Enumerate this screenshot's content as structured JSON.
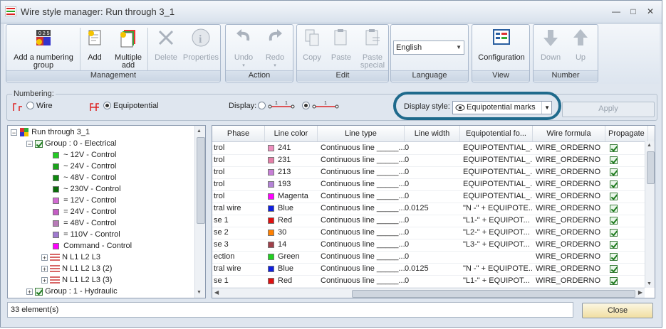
{
  "window": {
    "title": "Wire style manager: Run through 3_1"
  },
  "ribbon": {
    "groups": [
      {
        "label": "Management"
      },
      {
        "label": "Action"
      },
      {
        "label": "Edit"
      },
      {
        "label": "Language"
      },
      {
        "label": "View"
      },
      {
        "label": "Number"
      }
    ],
    "buttons": {
      "add_numbering_group": {
        "line1": "Add a numbering",
        "line2": "group"
      },
      "add": "Add",
      "multiple_add": {
        "line1": "Multiple",
        "line2": "add"
      },
      "delete": "Delete",
      "properties": "Properties",
      "undo": "Undo",
      "redo": "Redo",
      "copy": "Copy",
      "paste": "Paste",
      "paste_special": {
        "line1": "Paste",
        "line2": "special"
      },
      "configuration": "Configuration",
      "down": "Down",
      "up": "Up"
    },
    "language": {
      "value": "English"
    }
  },
  "numbering": {
    "label": "Numbering:",
    "wire": "Wire",
    "equipotential": "Equipotential",
    "display_label": "Display:",
    "display_style_label": "Display style:",
    "display_style_value": "Equipotential marks",
    "apply": "Apply"
  },
  "tree": {
    "root": "Run through 3_1",
    "group0": "Group : 0 - Electrical",
    "items": [
      {
        "label": "~  12V - Control",
        "color": "#22cc22"
      },
      {
        "label": "~  24V - Control",
        "color": "#1aa31a"
      },
      {
        "label": "~  48V - Control",
        "color": "#0e8a0e"
      },
      {
        "label": "~ 230V - Control",
        "color": "#0b6b0b"
      },
      {
        "label": "=  12V - Control",
        "color": "#d26ad2"
      },
      {
        "label": "=  24V - Control",
        "color": "#c45cc4"
      },
      {
        "label": "=  48V - Control",
        "color": "#b77ab7"
      },
      {
        "label": "= 110V - Control",
        "color": "#a07ad0"
      },
      {
        "label": "Command - Control",
        "color": "#ff00ff"
      }
    ],
    "sets": [
      "N L1 L2 L3",
      "N L1 L2 L3 (2)",
      "N L1 L2 L3 (3)"
    ],
    "group1": "Group : 1 - Hydraulic"
  },
  "grid": {
    "headers": [
      "Phase",
      "Line color",
      "Line type",
      "Line width",
      "Equipotential fo...",
      "Wire formula",
      "Propagate"
    ],
    "rows": [
      {
        "phase": "trol",
        "color_name": "241",
        "color": "#ee8fbe",
        "type": "Continuous line _____...",
        "width": "0",
        "equi": "EQUIPOTENTIAL_...",
        "formula": "WIRE_ORDERNO"
      },
      {
        "phase": "trol",
        "color_name": "231",
        "color": "#e57fa8",
        "type": "Continuous line _____...",
        "width": "0",
        "equi": "EQUIPOTENTIAL_...",
        "formula": "WIRE_ORDERNO"
      },
      {
        "phase": "trol",
        "color_name": "213",
        "color": "#c77fd6",
        "type": "Continuous line _____...",
        "width": "0",
        "equi": "EQUIPOTENTIAL_...",
        "formula": "WIRE_ORDERNO"
      },
      {
        "phase": "trol",
        "color_name": "193",
        "color": "#b483d6",
        "type": "Continuous line _____...",
        "width": "0",
        "equi": "EQUIPOTENTIAL_...",
        "formula": "WIRE_ORDERNO"
      },
      {
        "phase": "trol",
        "color_name": "Magenta",
        "color": "#ff00ff",
        "type": "Continuous line _____...",
        "width": "0",
        "equi": "EQUIPOTENTIAL_...",
        "formula": "WIRE_ORDERNO"
      },
      {
        "phase": "tral wire",
        "color_name": "Blue",
        "color": "#1020e0",
        "type": "Continuous line _____...",
        "width": "0.0125",
        "equi": "\"N -\" + EQUIPOTE...",
        "formula": "WIRE_ORDERNO"
      },
      {
        "phase": "se 1",
        "color_name": "Red",
        "color": "#e01010",
        "type": "Continuous line _____...",
        "width": "0",
        "equi": "\"L1-\" + EQUIPOT...",
        "formula": "WIRE_ORDERNO"
      },
      {
        "phase": "se 2",
        "color_name": "30",
        "color": "#ff8000",
        "type": "Continuous line _____...",
        "width": "0",
        "equi": "\"L2-\" + EQUIPOT...",
        "formula": "WIRE_ORDERNO"
      },
      {
        "phase": "se 3",
        "color_name": "14",
        "color": "#a0404a",
        "type": "Continuous line _____...",
        "width": "0",
        "equi": "\"L3-\" + EQUIPOT...",
        "formula": "WIRE_ORDERNO"
      },
      {
        "phase": "ection",
        "color_name": "Green",
        "color": "#20d020",
        "type": "Continuous line _____...",
        "width": "0",
        "equi": "",
        "formula": "WIRE_ORDERNO"
      },
      {
        "phase": "tral wire",
        "color_name": "Blue",
        "color": "#1020e0",
        "type": "Continuous line _____...",
        "width": "0.0125",
        "equi": "\"N -\" + EQUIPOTE...",
        "formula": "WIRE_ORDERNO"
      },
      {
        "phase": "se 1",
        "color_name": "Red",
        "color": "#e01010",
        "type": "Continuous line _____...",
        "width": "0",
        "equi": "\"L1-\" + EQUIPOT...",
        "formula": "WIRE_ORDERNO"
      }
    ]
  },
  "status": {
    "text": "33 element(s)",
    "close": "Close"
  }
}
